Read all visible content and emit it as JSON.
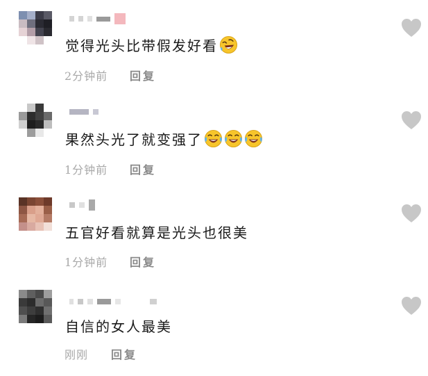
{
  "colors": {
    "heart": "#c7c7c7",
    "meta_text": "#a8a8a8",
    "reply_text": "#8a8a8a",
    "body_text": "#1a1a1a"
  },
  "comments": [
    {
      "text": "觉得光头比带假发好看",
      "emojis": [
        "rofl-emoji"
      ],
      "time": "2分钟前",
      "reply_label": "回复"
    },
    {
      "text": "果然头光了就变强了",
      "emojis": [
        "crying-laughing-emoji",
        "crying-laughing-emoji",
        "crying-laughing-emoji"
      ],
      "time": "1分钟前",
      "reply_label": "回复"
    },
    {
      "text": "五官好看就算是光头也很美",
      "emojis": [],
      "time": "1分钟前",
      "reply_label": "回复"
    },
    {
      "text": "自信的女人最美",
      "emojis": [],
      "time": "刚刚",
      "reply_label": "回复"
    }
  ]
}
